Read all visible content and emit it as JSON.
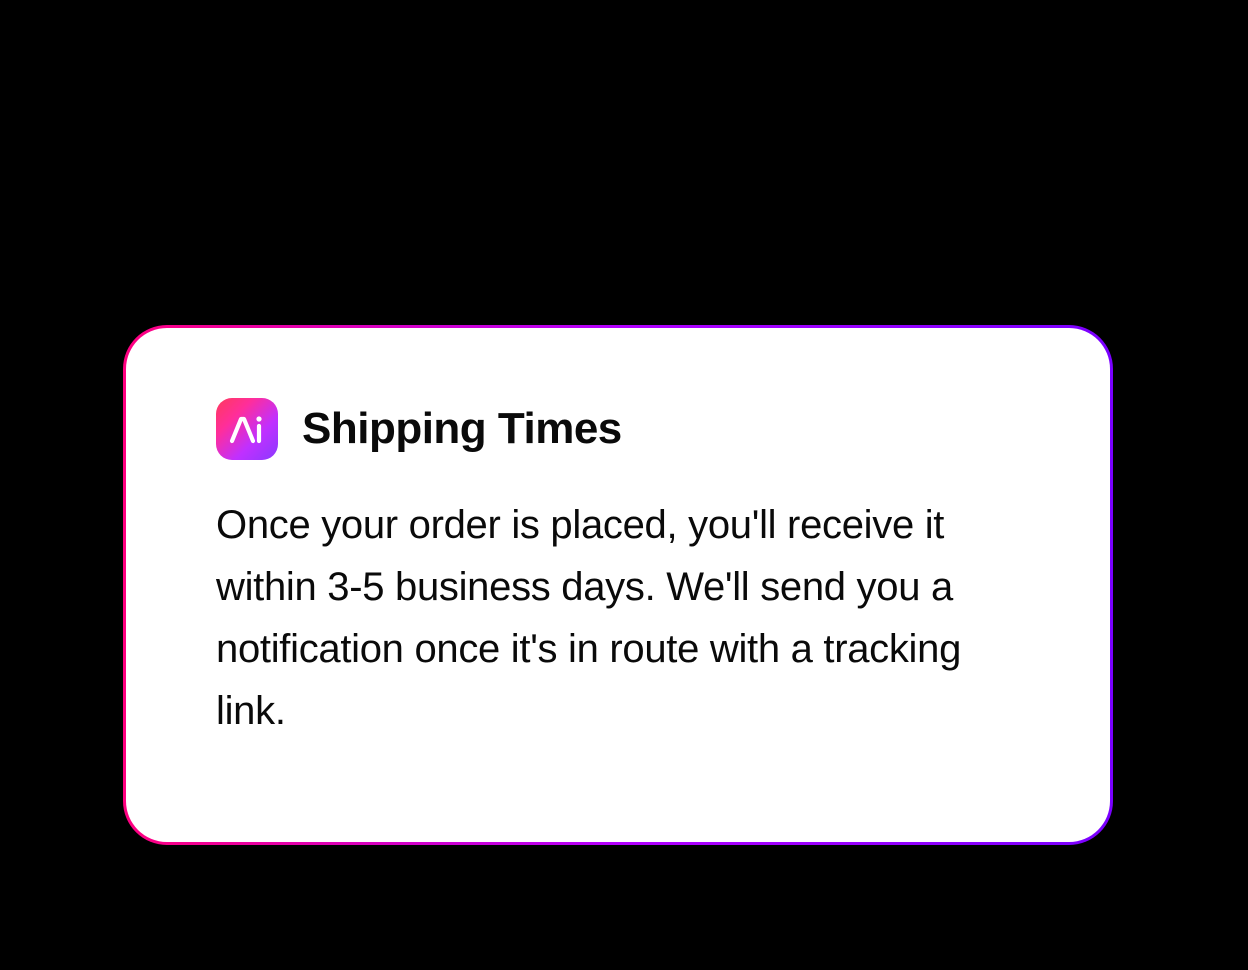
{
  "card": {
    "title": "Shipping Times",
    "body": "Once your order is placed, you'll receive it within 3-5 business days. We'll send you a notification once it's in route with a tracking link.",
    "icon_name": "ai-app-icon"
  }
}
